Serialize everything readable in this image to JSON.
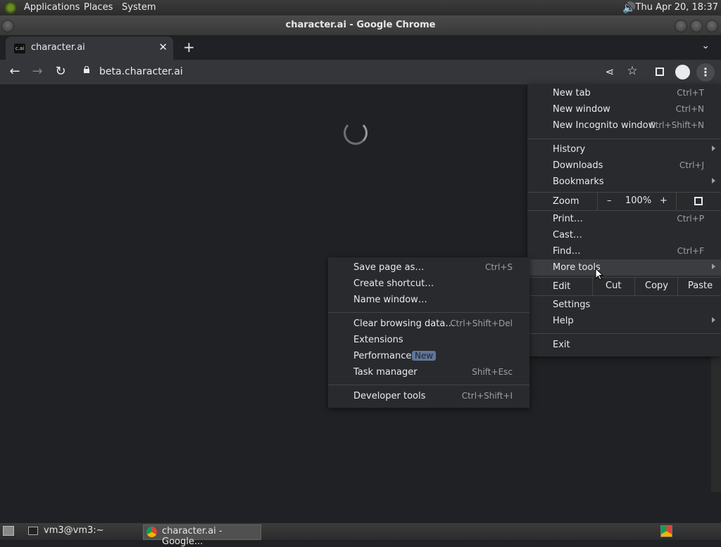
{
  "top_panel": {
    "menus": [
      "Applications",
      "Places",
      "System"
    ],
    "clock": "Thu Apr 20, 18:37"
  },
  "window": {
    "title": "character.ai - Google Chrome"
  },
  "tab": {
    "favicon_text": "c.ai",
    "title": "character.ai"
  },
  "toolbar": {
    "url": "beta.character.ai"
  },
  "chrome_menu": {
    "new_tab": {
      "label": "New tab",
      "shortcut": "Ctrl+T"
    },
    "new_window": {
      "label": "New window",
      "shortcut": "Ctrl+N"
    },
    "new_incognito": {
      "label": "New Incognito window",
      "shortcut": "Ctrl+Shift+N"
    },
    "history": {
      "label": "History"
    },
    "downloads": {
      "label": "Downloads",
      "shortcut": "Ctrl+J"
    },
    "bookmarks": {
      "label": "Bookmarks"
    },
    "zoom": {
      "label": "Zoom",
      "minus": "–",
      "value": "100%",
      "plus": "+"
    },
    "print": {
      "label": "Print…",
      "shortcut": "Ctrl+P"
    },
    "cast": {
      "label": "Cast…"
    },
    "find": {
      "label": "Find…",
      "shortcut": "Ctrl+F"
    },
    "more_tools": {
      "label": "More tools"
    },
    "edit": {
      "label": "Edit",
      "cut": "Cut",
      "copy": "Copy",
      "paste": "Paste"
    },
    "settings": {
      "label": "Settings"
    },
    "help": {
      "label": "Help"
    },
    "exit": {
      "label": "Exit"
    }
  },
  "more_tools_menu": {
    "save_page": {
      "label": "Save page as…",
      "shortcut": "Ctrl+S"
    },
    "create_shortcut": {
      "label": "Create shortcut…"
    },
    "name_window": {
      "label": "Name window…"
    },
    "clear_data": {
      "label": "Clear browsing data…",
      "shortcut": "Ctrl+Shift+Del"
    },
    "extensions": {
      "label": "Extensions"
    },
    "performance": {
      "label": "Performance",
      "badge": "New"
    },
    "task_manager": {
      "label": "Task manager",
      "shortcut": "Shift+Esc"
    },
    "dev_tools": {
      "label": "Developer tools",
      "shortcut": "Ctrl+Shift+I"
    }
  },
  "bottom_panel": {
    "tasks": [
      "vm3@vm3:~",
      "character.ai - Google..."
    ]
  }
}
